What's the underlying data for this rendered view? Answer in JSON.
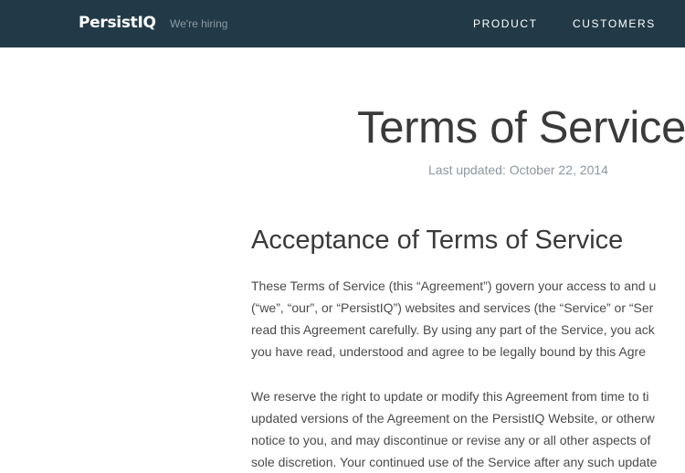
{
  "header": {
    "brand": "PersistIQ",
    "hiring_link": "We're hiring",
    "nav": {
      "product": "PRODUCT",
      "customers": "CUSTOMERS"
    },
    "background_color": "#223a48"
  },
  "main": {
    "title": "Terms of Service",
    "last_updated": "Last updated: October 22, 2014",
    "section_heading": "Acceptance of Terms of Service",
    "paragraph_1": [
      "These Terms of Service (this “Agreement”) govern your access to and u",
      "(“we”, “our”, or “PersistIQ”) websites and services (the “Service” or “Ser",
      "read this Agreement carefully. By using any part of the Service, you ack",
      "you have read, understood and agree to be legally bound by this Agre"
    ],
    "paragraph_2": [
      "We reserve the right to update or modify this Agreement from time to ti",
      "updated versions of the Agreement on the PersistIQ Website, or otherw",
      "notice to you, and may discontinue or revise any or all other aspects of",
      "sole discretion. Your continued use of the Service after any such update"
    ]
  }
}
